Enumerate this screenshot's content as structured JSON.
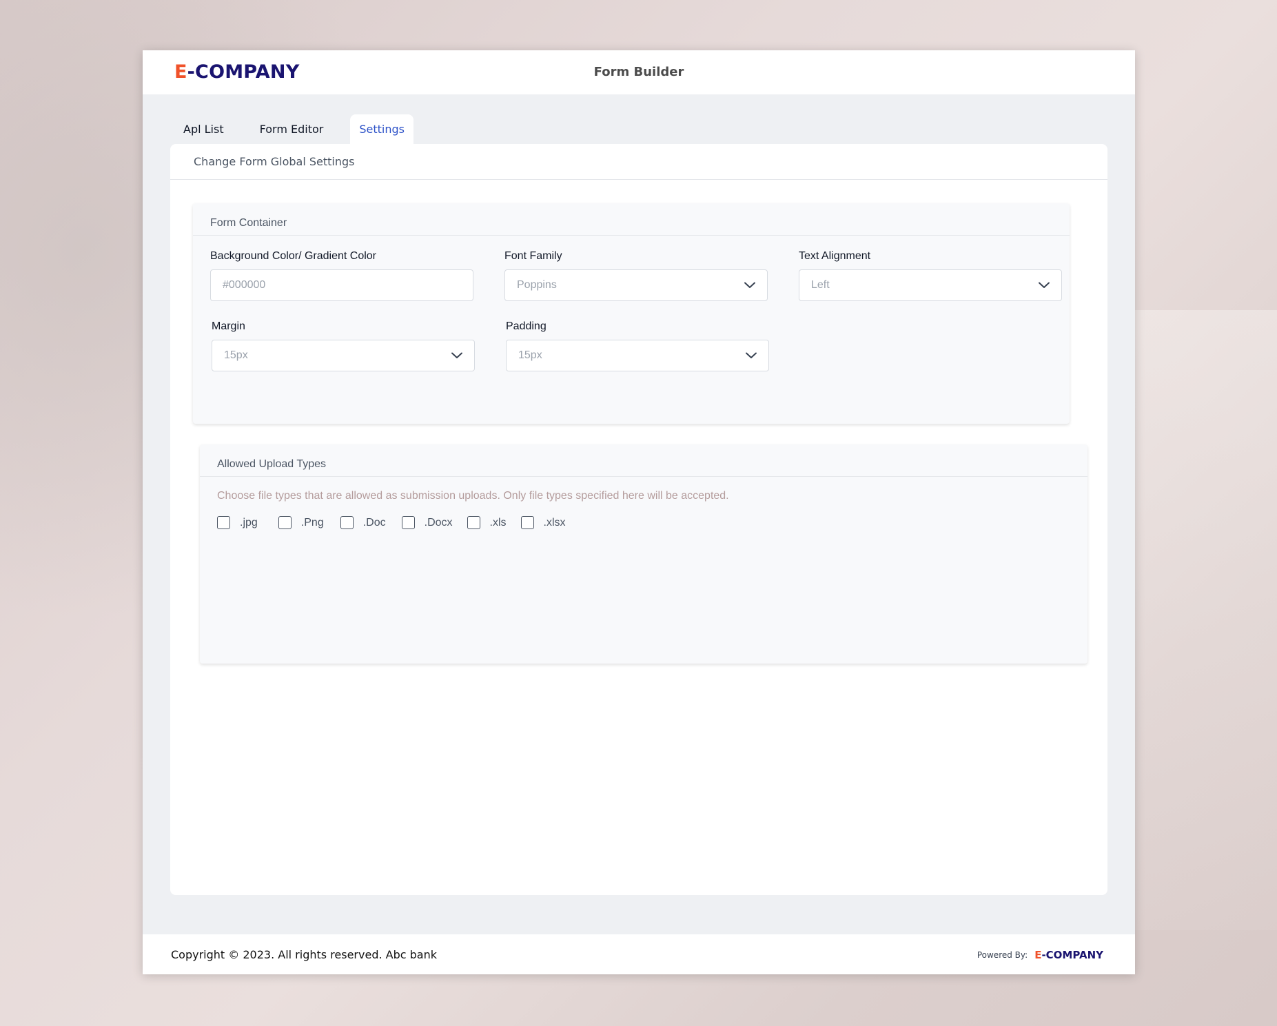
{
  "app": {
    "logo": {
      "prefix": "E",
      "rest": "-COMPANY"
    },
    "title": "Form Builder"
  },
  "tabs": [
    {
      "label": "Apl List",
      "active": false
    },
    {
      "label": "Form Editor",
      "active": false
    },
    {
      "label": "Settings",
      "active": true
    }
  ],
  "card": {
    "header": "Change Form Global Settings"
  },
  "form_container": {
    "title": "Form Container",
    "background": {
      "label": "Background Color/ Gradient Color",
      "placeholder": "#000000"
    },
    "font_family": {
      "label": "Font Family",
      "value": "Poppins"
    },
    "text_alignment": {
      "label": "Text Alignment",
      "value": "Left"
    },
    "margin": {
      "label": "Margin",
      "value": "15px"
    },
    "padding": {
      "label": "Padding",
      "value": "15px"
    }
  },
  "upload_types": {
    "title": "Allowed Upload Types",
    "hint": "Choose file types that are allowed as submission uploads. Only file types specified here will be accepted.",
    "options": [
      {
        "label": ".jpg",
        "checked": false
      },
      {
        "label": ".Png",
        "checked": false
      },
      {
        "label": ".Doc",
        "checked": false
      },
      {
        "label": ".Docx",
        "checked": false
      },
      {
        "label": ".xls",
        "checked": false
      },
      {
        "label": ".xlsx",
        "checked": false
      }
    ]
  },
  "footer": {
    "copyright": "Copyright © 2023. All rights reserved. Abc bank",
    "powered_by": "Powered By:",
    "logo": {
      "prefix": "E",
      "rest": "-COMPANY"
    }
  },
  "colors": {
    "brand_orange": "#f0522a",
    "brand_navy": "#1a1470",
    "active_tab": "#2d52c8"
  },
  "icons": {
    "select_arrow": "chevron-down-icon"
  }
}
